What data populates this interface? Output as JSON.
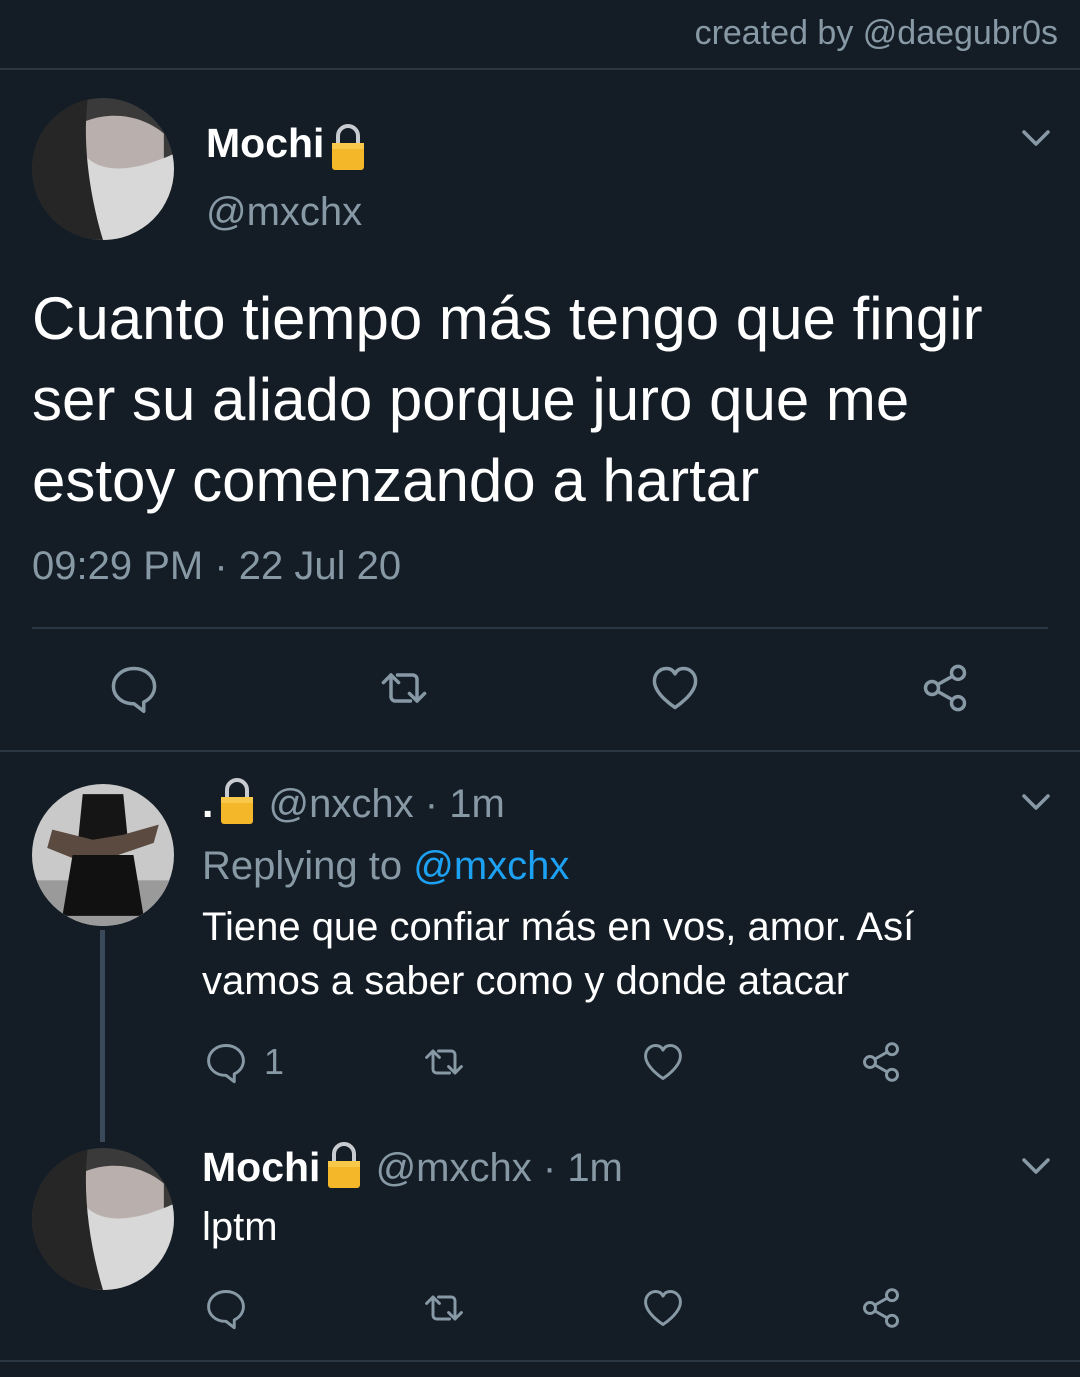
{
  "credit": "created by @daegubr0s",
  "main_tweet": {
    "name": "Mochi",
    "handle": "@mxchx",
    "text": "Cuanto tiempo más tengo que fingir ser su aliado porque juro que me estoy comenzando a hartar",
    "time": "09:29 PM",
    "sep": "·",
    "date": "22 Jul 20"
  },
  "reply1": {
    "name": ".",
    "handle": "@nxchx",
    "sep": "·",
    "age": "1m",
    "replying_label": "Replying to",
    "replying_to": "@mxchx",
    "text": "Tiene que confiar más en vos, amor. Así vamos a saber como y donde atacar",
    "reply_count": "1"
  },
  "reply2": {
    "name": "Mochi",
    "handle": "@mxchx",
    "sep": "·",
    "age": "1m",
    "text": "lptm"
  },
  "icons": {
    "reply": "speech-bubble-icon",
    "retweet": "retweet-icon",
    "like": "heart-icon",
    "share": "share-icon",
    "lock": "lock-emoji-icon",
    "chevron": "chevron-down-icon"
  },
  "colors": {
    "background": "#141d26",
    "muted": "#8899a6",
    "link": "#1da1f2",
    "divider": "#2a3642",
    "lock": "#f5b72a"
  }
}
